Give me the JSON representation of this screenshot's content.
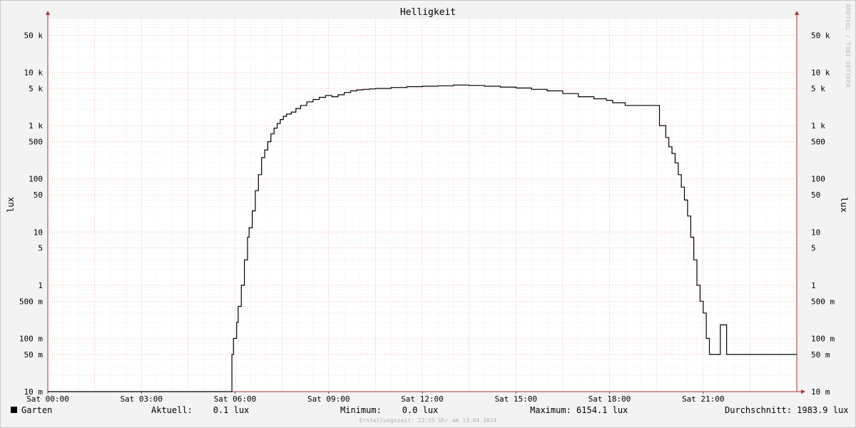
{
  "chart_data": {
    "type": "line",
    "title": "Helligkeit",
    "ylabel": "lux",
    "yscale": "log",
    "ylim": [
      0.01,
      100000
    ],
    "xlim": [
      0,
      24
    ],
    "x_unit": "hours since Sat 00:00",
    "x_ticks": [
      {
        "v": 0,
        "label": "Sat 00:00"
      },
      {
        "v": 3,
        "label": "Sat 03:00"
      },
      {
        "v": 6,
        "label": "Sat 06:00"
      },
      {
        "v": 9,
        "label": "Sat 09:00"
      },
      {
        "v": 12,
        "label": "Sat 12:00"
      },
      {
        "v": 15,
        "label": "Sat 15:00"
      },
      {
        "v": 18,
        "label": "Sat 18:00"
      },
      {
        "v": 21,
        "label": "Sat 21:00"
      }
    ],
    "y_ticks": [
      {
        "v": 0.01,
        "label": "10 m"
      },
      {
        "v": 0.05,
        "label": "50 m"
      },
      {
        "v": 0.1,
        "label": "100 m"
      },
      {
        "v": 0.5,
        "label": "500 m"
      },
      {
        "v": 1,
        "label": "1"
      },
      {
        "v": 5,
        "label": "5"
      },
      {
        "v": 10,
        "label": "10"
      },
      {
        "v": 50,
        "label": "50"
      },
      {
        "v": 100,
        "label": "100"
      },
      {
        "v": 500,
        "label": "500"
      },
      {
        "v": 1000,
        "label": "1 k"
      },
      {
        "v": 5000,
        "label": "5 k"
      },
      {
        "v": 10000,
        "label": "10 k"
      },
      {
        "v": 50000,
        "label": "50 k"
      }
    ],
    "grid": true,
    "series": [
      {
        "name": "Garten",
        "color": "#000000",
        "x": [
          0,
          5.85,
          5.9,
          5.95,
          6.05,
          6.1,
          6.2,
          6.3,
          6.4,
          6.45,
          6.55,
          6.65,
          6.75,
          6.85,
          6.95,
          7.05,
          7.15,
          7.25,
          7.35,
          7.45,
          7.55,
          7.65,
          7.8,
          7.95,
          8.1,
          8.3,
          8.5,
          8.7,
          8.9,
          9.1,
          9.3,
          9.5,
          9.7,
          9.9,
          10.1,
          10.3,
          10.5,
          11.0,
          11.5,
          12.0,
          12.5,
          13.0,
          13.5,
          14.0,
          14.5,
          15.0,
          15.5,
          16.0,
          16.5,
          17.0,
          17.5,
          17.9,
          18.1,
          18.5,
          19.0,
          19.5,
          19.6,
          19.8,
          19.9,
          20.0,
          20.1,
          20.2,
          20.3,
          20.4,
          20.5,
          20.6,
          20.7,
          20.8,
          20.9,
          21.0,
          21.1,
          21.2,
          21.3,
          21.5,
          21.55,
          21.7,
          21.75,
          24
        ],
        "y": [
          0.01,
          0.01,
          0.05,
          0.1,
          0.2,
          0.4,
          1,
          3,
          8,
          12,
          25,
          60,
          120,
          250,
          350,
          500,
          700,
          900,
          1100,
          1300,
          1500,
          1650,
          1800,
          2100,
          2400,
          2800,
          3100,
          3400,
          3700,
          3500,
          3800,
          4200,
          4500,
          4700,
          4800,
          4900,
          5000,
          5200,
          5400,
          5500,
          5600,
          5800,
          5700,
          5500,
          5300,
          5100,
          4800,
          4500,
          4000,
          3500,
          3200,
          3000,
          2700,
          2400,
          2400,
          2400,
          1000,
          600,
          400,
          300,
          200,
          120,
          70,
          40,
          20,
          8,
          3,
          1,
          0.5,
          0.3,
          0.1,
          0.05,
          0.05,
          0.05,
          0.18,
          0.18,
          0.05,
          0.05
        ]
      }
    ],
    "legend": {
      "name": "Garten",
      "aktuell": "Aktuell:    0.1 lux",
      "minimum": "Minimum:    0.0 lux",
      "maximum": "Maximum: 6154.1 lux",
      "durchschnitt": "Durchschnitt: 1983.9 lux"
    },
    "footer": "Erstellungszeit: 23:55 Uhr am 13.04.2024",
    "watermark": "RRDTOOL / TOBI OETIKER"
  }
}
